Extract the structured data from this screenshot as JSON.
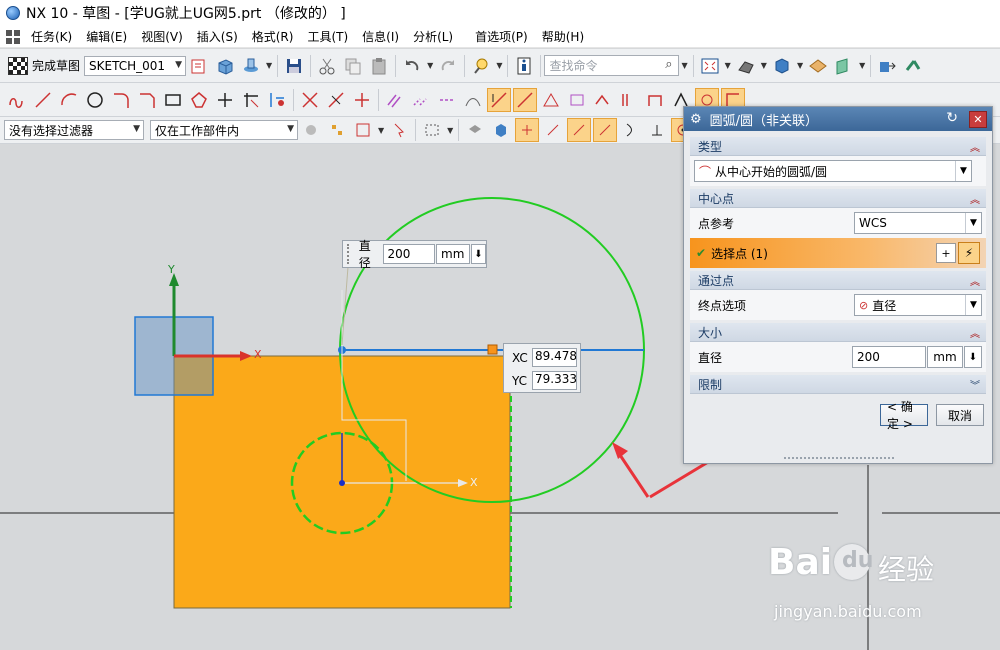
{
  "window": {
    "title": "NX 10 - 草图 - [学UG就上UG网5.prt （修改的） ]"
  },
  "menu": [
    "任务(K)",
    "编辑(E)",
    "视图(V)",
    "插入(S)",
    "格式(R)",
    "工具(T)",
    "信息(I)",
    "分析(L)",
    "首选项(P)",
    "帮助(H)"
  ],
  "toolbar": {
    "finish_sketch": "完成草图",
    "sketch_name": "SKETCH_001",
    "search_placeholder": "查找命令"
  },
  "filters": {
    "type_filter": "没有选择过滤器",
    "scope_filter": "仅在工作部件内"
  },
  "canvas": {
    "diameter_label": "直径",
    "diameter_value": "200",
    "diameter_unit": "mm",
    "xc_label": "XC",
    "xc_value": "89.478",
    "yc_label": "YC",
    "yc_value": "79.333",
    "axis_x": "X",
    "axis_y": "Y",
    "axis_x2": "X"
  },
  "dialog": {
    "title": "圆弧/圆（非关联）",
    "section_type": "类型",
    "type_value": "从中心开始的圆弧/圆",
    "section_center": "中心点",
    "point_ref_label": "点参考",
    "point_ref_value": "WCS",
    "select_point": "选择点 (1)",
    "section_through": "通过点",
    "end_option_label": "终点选项",
    "end_option_value": "直径",
    "section_size": "大小",
    "diameter_label": "直径",
    "diameter_value": "200",
    "diameter_unit": "mm",
    "section_limits": "限制",
    "ok": "< 确定 >",
    "cancel": "取消"
  },
  "watermark": {
    "brand": "Bai",
    "brand2": "du",
    "brand_cn": "经验",
    "url": "jingyan.baidu.com"
  },
  "colors": {
    "accent": "#fba919",
    "sketch_green": "#22cc22",
    "sketch_blue": "#2178d4",
    "highlight": "#f7941d"
  }
}
